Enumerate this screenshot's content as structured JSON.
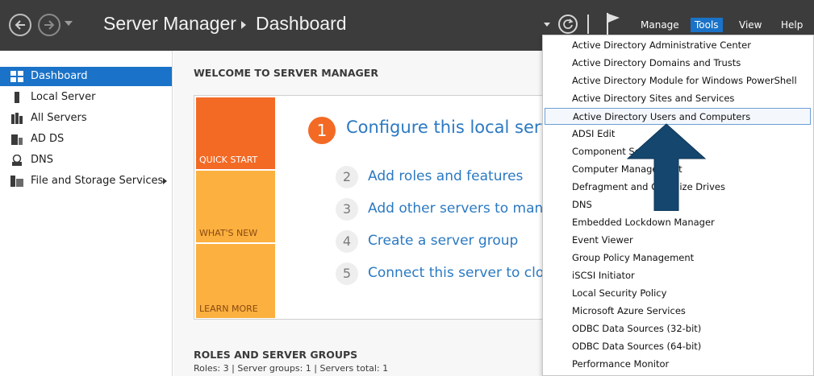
{
  "titlebar": {
    "app_title": "Server Manager",
    "page_title": "Dashboard",
    "menus": {
      "manage": "Manage",
      "tools": "Tools",
      "view": "View",
      "help": "Help"
    },
    "colors": {
      "bg": "#3c3c3c",
      "active_menu": "#1a73c8"
    }
  },
  "sidebar": {
    "items": [
      {
        "label": "Dashboard",
        "icon": "dashboard-icon",
        "active": true
      },
      {
        "label": "Local Server",
        "icon": "server-icon"
      },
      {
        "label": "All Servers",
        "icon": "servers-icon"
      },
      {
        "label": "AD DS",
        "icon": "ad-ds-icon"
      },
      {
        "label": "DNS",
        "icon": "dns-icon"
      },
      {
        "label": "File and Storage Services",
        "icon": "storage-icon",
        "has_submenu": true
      }
    ]
  },
  "main": {
    "welcome_heading": "WELCOME TO SERVER MANAGER",
    "tiles": {
      "quick_start": "QUICK START",
      "whats_new": "WHAT'S NEW",
      "learn_more": "LEARN MORE"
    },
    "steps": [
      {
        "num": "1",
        "label": "Configure this local server"
      },
      {
        "num": "2",
        "label": "Add roles and features"
      },
      {
        "num": "3",
        "label": "Add other servers to manage"
      },
      {
        "num": "4",
        "label": "Create a server group"
      },
      {
        "num": "5",
        "label": "Connect this server to cloud services"
      }
    ],
    "roles_heading": "ROLES AND SERVER GROUPS",
    "roles_summary": "Roles: 3   |   Server groups: 1   |   Servers total: 1"
  },
  "tools_menu": {
    "items": [
      "Active Directory Administrative Center",
      "Active Directory Domains and Trusts",
      "Active Directory Module for Windows PowerShell",
      "Active Directory Sites and Services",
      "Active Directory Users and Computers",
      "ADSI Edit",
      "Component Services",
      "Computer Management",
      "Defragment and Optimize Drives",
      "DNS",
      "Embedded Lockdown Manager",
      "Event Viewer",
      "Group Policy Management",
      "iSCSI Initiator",
      "Local Security Policy",
      "Microsoft Azure Services",
      "ODBC Data Sources (32-bit)",
      "ODBC Data Sources (64-bit)",
      "Performance Monitor"
    ],
    "selected_index": 4
  },
  "annotation": {
    "icon": "down-arrow-icon",
    "color": "#14466e"
  }
}
